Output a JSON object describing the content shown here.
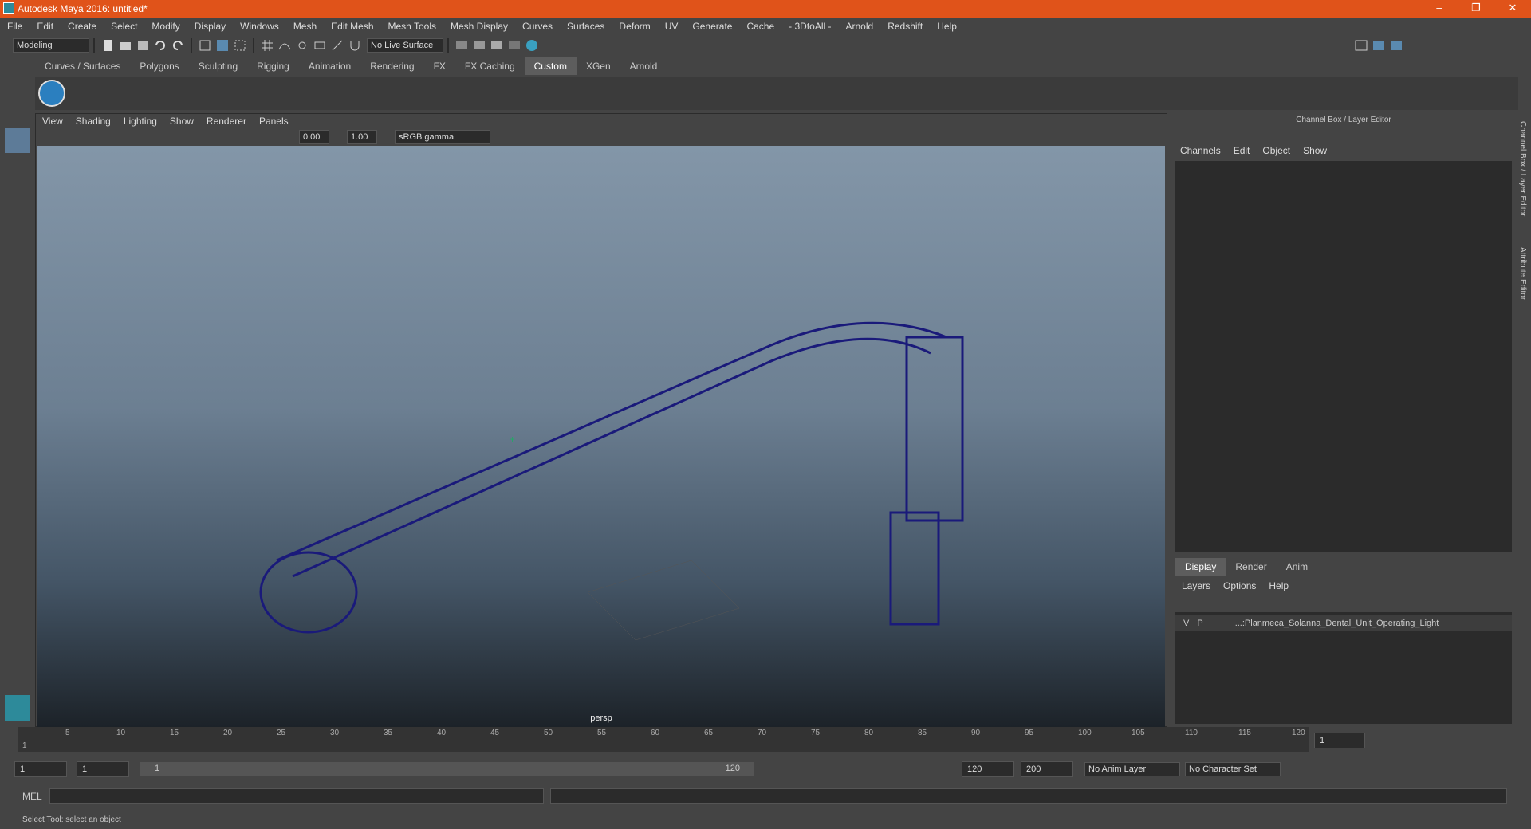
{
  "window": {
    "title": "Autodesk Maya 2016: untitled*"
  },
  "menubar": {
    "items": [
      "File",
      "Edit",
      "Create",
      "Select",
      "Modify",
      "Display",
      "Windows",
      "Mesh",
      "Edit Mesh",
      "Mesh Tools",
      "Mesh Display",
      "Curves",
      "Surfaces",
      "Deform",
      "UV",
      "Generate",
      "Cache",
      "- 3DtoAll -",
      "Arnold",
      "Redshift",
      "Help"
    ]
  },
  "statusline": {
    "mode": "Modeling",
    "live_surface": "No Live Surface"
  },
  "shelf": {
    "tabs": [
      "Curves / Surfaces",
      "Polygons",
      "Sculpting",
      "Rigging",
      "Animation",
      "Rendering",
      "FX",
      "FX Caching",
      "Custom",
      "XGen",
      "Arnold"
    ],
    "active": "Custom"
  },
  "viewport": {
    "menu": [
      "View",
      "Shading",
      "Lighting",
      "Show",
      "Renderer",
      "Panels"
    ],
    "exposure": "0.00",
    "gamma": "1.00",
    "colorspace": "sRGB gamma",
    "camera": "persp"
  },
  "channelbox": {
    "title": "Channel Box / Layer Editor",
    "menu": [
      "Channels",
      "Edit",
      "Object",
      "Show"
    ]
  },
  "layers": {
    "tabs": [
      "Display",
      "Render",
      "Anim"
    ],
    "active": "Display",
    "menu": [
      "Layers",
      "Options",
      "Help"
    ],
    "row": {
      "v": "V",
      "p": "P",
      "name": "...:Planmeca_Solanna_Dental_Unit_Operating_Light"
    }
  },
  "sidetabs": {
    "channel": "Channel Box / Layer Editor",
    "attribute": "Attribute Editor"
  },
  "timeline": {
    "ticks": [
      "5",
      "10",
      "15",
      "20",
      "25",
      "30",
      "35",
      "40",
      "45",
      "50",
      "55",
      "60",
      "65",
      "70",
      "75",
      "80",
      "85",
      "90",
      "95",
      "100",
      "105",
      "110",
      "115",
      "120"
    ],
    "current": "1",
    "frame_field": "1"
  },
  "range": {
    "start": "1",
    "start2": "1",
    "slider_start": "1",
    "slider_end": "120",
    "end": "120",
    "end2": "200",
    "anim_layer": "No Anim Layer",
    "char_set": "No Character Set"
  },
  "mel": {
    "label": "MEL"
  },
  "help": {
    "text": "Select Tool: select an object"
  }
}
